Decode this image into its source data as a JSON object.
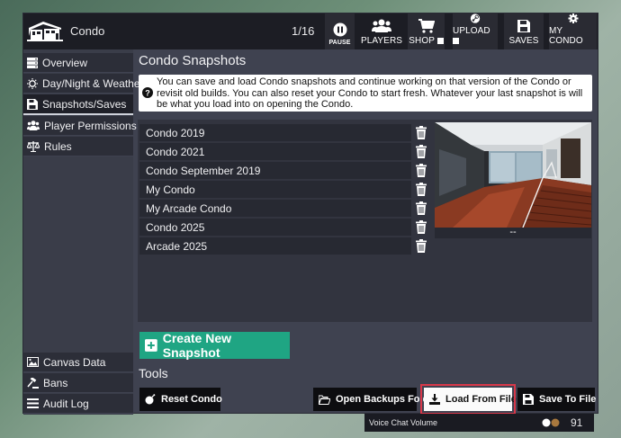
{
  "app": {
    "title": "Condo",
    "page_indicator": "1/16"
  },
  "topbar": {
    "pause": "PAUSE",
    "players": "PLAYERS",
    "shop": "SHOP",
    "upload": "UPLOAD",
    "saves": "SAVES",
    "my_condo": "MY CONDO"
  },
  "sidebar": {
    "top_items": [
      {
        "label": "Overview",
        "icon": "server-icon"
      },
      {
        "label": "Day/Night & Weather",
        "icon": "sun-icon"
      },
      {
        "label": "Snapshots/Saves",
        "icon": "save-icon",
        "active": true
      },
      {
        "label": "Player Permissions",
        "icon": "users-icon"
      },
      {
        "label": "Rules",
        "icon": "scale-icon"
      }
    ],
    "bottom_items": [
      {
        "label": "Canvas Data",
        "icon": "image-icon"
      },
      {
        "label": "Bans",
        "icon": "gavel-icon"
      },
      {
        "label": "Audit Log",
        "icon": "list-icon"
      }
    ]
  },
  "main": {
    "section_title": "Condo Snapshots",
    "info": "You can save and load Condo snapshots and continue working on that version of the Condo or revisit old builds. You can also reset your Condo to start fresh. Whatever your last snapshot is will be what you load into on opening the Condo.",
    "snapshots": [
      "Condo 2019",
      "Condo 2021",
      "Condo September 2019",
      "My Condo",
      "My Arcade Condo",
      "Condo 2025",
      "Arcade 2025"
    ],
    "preview_caption": "--",
    "create_button": "Create New Snapshot",
    "tools_title": "Tools",
    "tools": {
      "reset": "Reset Condo",
      "open_backups": "Open Backups Folder",
      "load_file": "Load From File",
      "save_file": "Save To File"
    }
  },
  "voice": {
    "label": "Voice Chat Volume",
    "value": "91"
  },
  "colors": {
    "accent_green": "#1fa583",
    "highlight_red": "#d8384a"
  }
}
